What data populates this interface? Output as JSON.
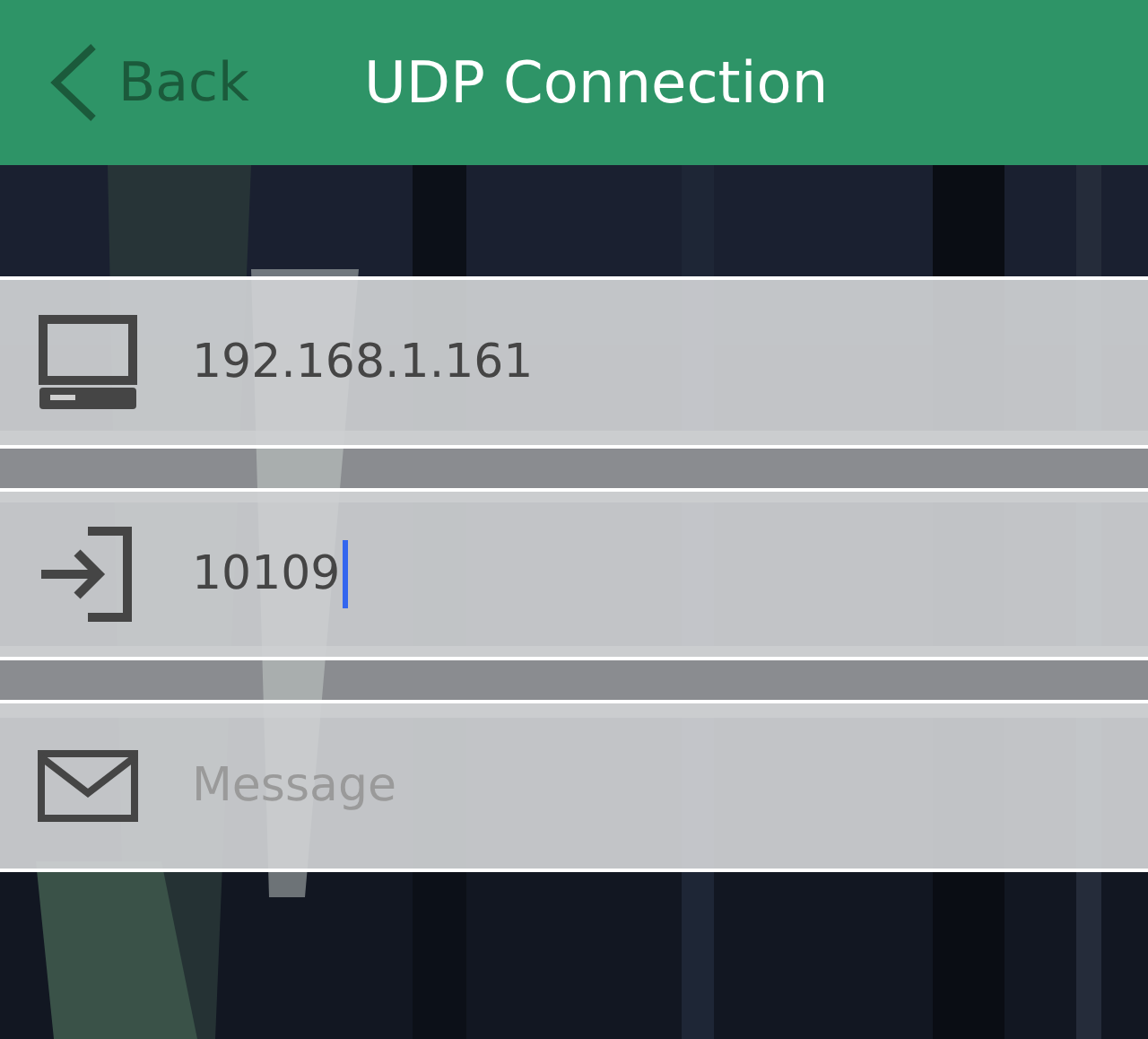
{
  "header": {
    "back_label": "Back",
    "title": "UDP Connection"
  },
  "fields": [
    {
      "kind": "computer",
      "value": "192.168.1.161",
      "focused": false
    },
    {
      "kind": "port",
      "value": "10109",
      "focused": true
    },
    {
      "kind": "message",
      "placeholder": "Message",
      "focused": false
    }
  ]
}
